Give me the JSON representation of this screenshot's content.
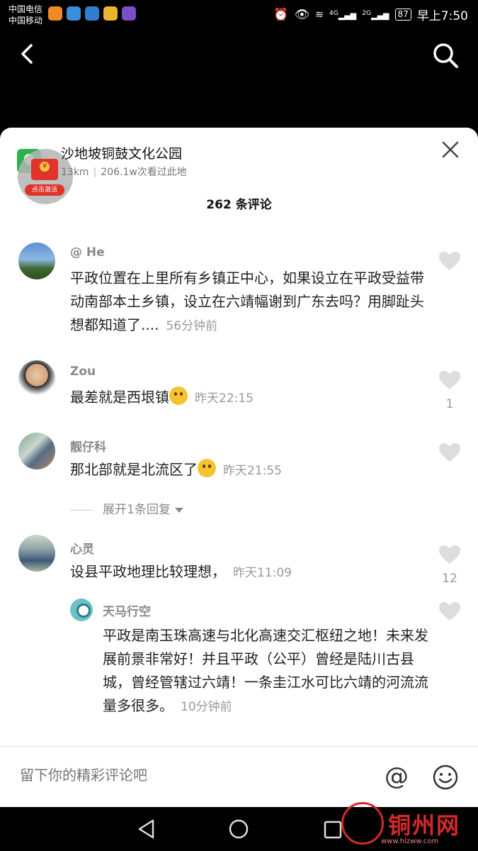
{
  "status_bar": {
    "carrier_1": "中国电信",
    "carrier_2": "中国移动",
    "network_1": "4G",
    "network_2": "2G",
    "battery": "87",
    "time": "早上7:50"
  },
  "nav": {
    "back_icon": "chevron-left-icon",
    "search_icon": "search-icon"
  },
  "location": {
    "name": "沙地坡铜鼓文化公园",
    "distance": "13km",
    "separator": "|",
    "visitors": "206.1w次看过此地",
    "promo_label": "点击激活"
  },
  "comments_header": "262 条评论",
  "comments": [
    {
      "username": "@ He",
      "text": "平政位置在上里所有乡镇正中心，如果设立在平政受益带动南部本土乡镇，设立在六靖幅谢到广东去吗？用脚趾头想都知道了....",
      "time": "56分钟前",
      "likes": ""
    },
    {
      "username": "Zou",
      "text": "最差就是西垠镇",
      "time": "昨天22:15",
      "likes": "1"
    },
    {
      "username": "靓仔科",
      "text": "那北部就是北流区了",
      "time": "昨天21:55",
      "likes": "",
      "expand_label": "展开1条回复"
    },
    {
      "username": "心灵",
      "text": "设县平政地理比较理想，",
      "time": "昨天11:09",
      "likes": "12",
      "reply": {
        "username": "天马行空",
        "text": "平政是南玉珠高速与北化高速交汇枢纽之地！未来发展前景非常好！并且平政（公平）曾经是陆川古县城，曾经管辖过六靖！一条圭江水可比六靖的河流流量多很多。",
        "time": "10分钟前"
      }
    }
  ],
  "input": {
    "placeholder": "留下你的精彩评论吧",
    "at_symbol": "@"
  },
  "watermark": {
    "text": "铜州网",
    "url": "www.hlzww.com"
  },
  "colors": {
    "sheet_bg": "#ffffff",
    "username": "#8a8a8a",
    "time": "#999999",
    "accent_red": "#d6292a"
  }
}
